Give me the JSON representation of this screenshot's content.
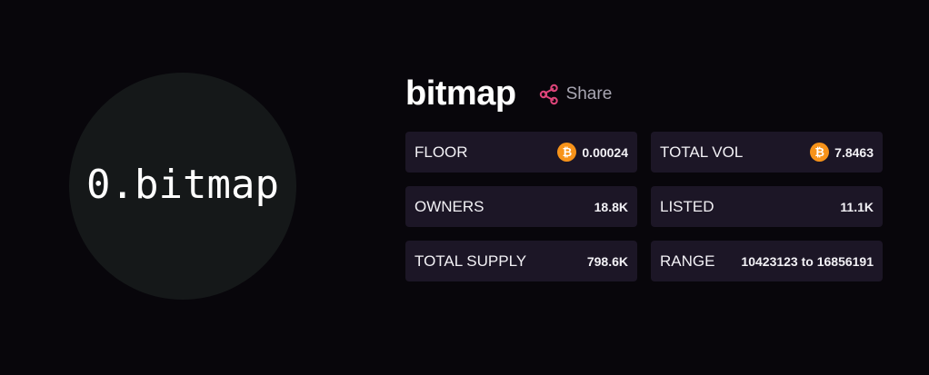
{
  "collection": {
    "image_text": "0.bitmap",
    "name": "bitmap",
    "share_label": "Share"
  },
  "stats": {
    "floor": {
      "label": "FLOOR",
      "value": "0.00024",
      "icon": "bitcoin-icon"
    },
    "total_vol": {
      "label": "TOTAL VOL",
      "value": "7.8463",
      "icon": "bitcoin-icon"
    },
    "owners": {
      "label": "OWNERS",
      "value": "18.8K"
    },
    "listed": {
      "label": "LISTED",
      "value": "11.1K"
    },
    "total_supply": {
      "label": "TOTAL SUPPLY",
      "value": "798.6K"
    },
    "range": {
      "label": "RANGE",
      "value": "10423123 to 16856191"
    }
  },
  "icons": {
    "share": "share-icon",
    "bitcoin_glyph": "₿"
  },
  "colors": {
    "background": "#08060b",
    "card": "#1c1626",
    "avatar_bg": "#151819",
    "share_accent": "#e0457b",
    "bitcoin": "#f7931a"
  }
}
